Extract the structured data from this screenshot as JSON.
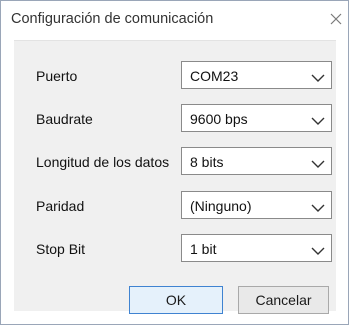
{
  "window": {
    "title": "Configuración de comunicación",
    "close_icon": "close-icon"
  },
  "fields": [
    {
      "label": "Puerto",
      "value": "COM23"
    },
    {
      "label": "Baudrate",
      "value": "9600 bps"
    },
    {
      "label": "Longitud de los datos",
      "value": "8 bits"
    },
    {
      "label": "Paridad",
      "value": "(Ninguno)"
    },
    {
      "label": "Stop Bit",
      "value": "1 bit"
    }
  ],
  "buttons": {
    "ok_label": "OK",
    "cancel_label": "Cancelar"
  },
  "colors": {
    "accent": "#3f83d1",
    "ok_bg": "#e5f1fb",
    "client_bg": "#f0f0f0"
  }
}
